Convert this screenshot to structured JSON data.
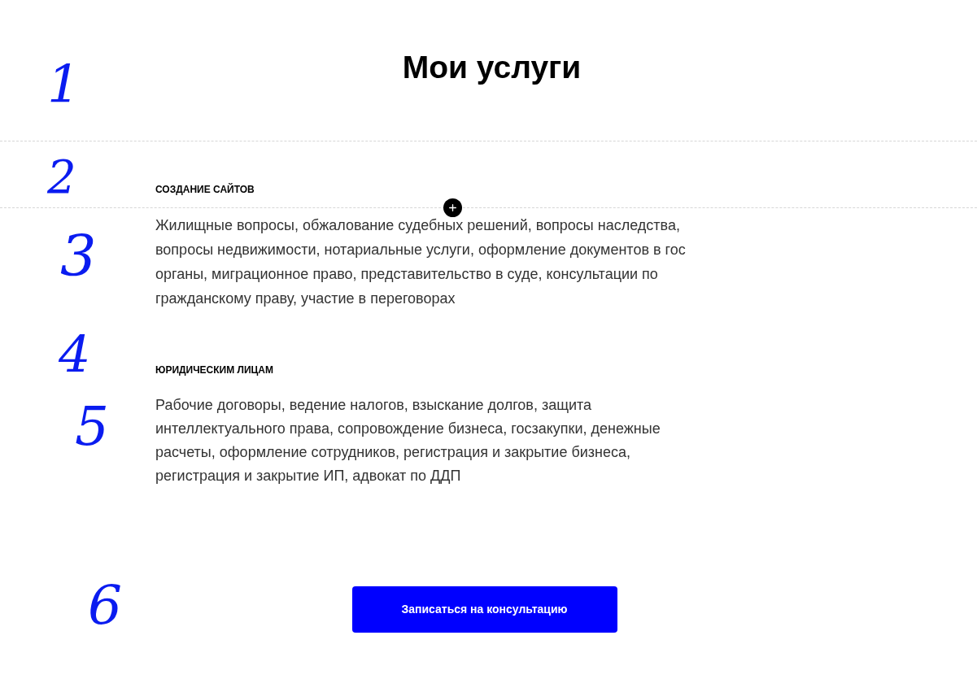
{
  "title": "Мои услуги",
  "services": [
    {
      "heading": "СОЗДАНИЕ САЙТОВ",
      "text": "Жилищные вопросы, обжалование судебных решений, вопросы наследства, вопросы недвижимости, нотариальные услуги, оформление документов в гос органы, миграционное право, представительство в суде, консультации по гражданскому праву, участие в переговорах"
    },
    {
      "heading": "ЮРИДИЧЕСКИМ ЛИЦАМ",
      "text": "Рабочие договоры, ведение налогов, взыскание долгов, защита интеллектуального права, сопровождение бизнеса, госзакупки, денежные расчеты, оформление сотрудников, регистрация и закрытие бизнеса, регистрация и закрытие ИП, адвокат по ДДП"
    }
  ],
  "button": "Записаться на консультацию",
  "annotations": [
    "1",
    "2",
    "3",
    "4",
    "5",
    "6"
  ]
}
